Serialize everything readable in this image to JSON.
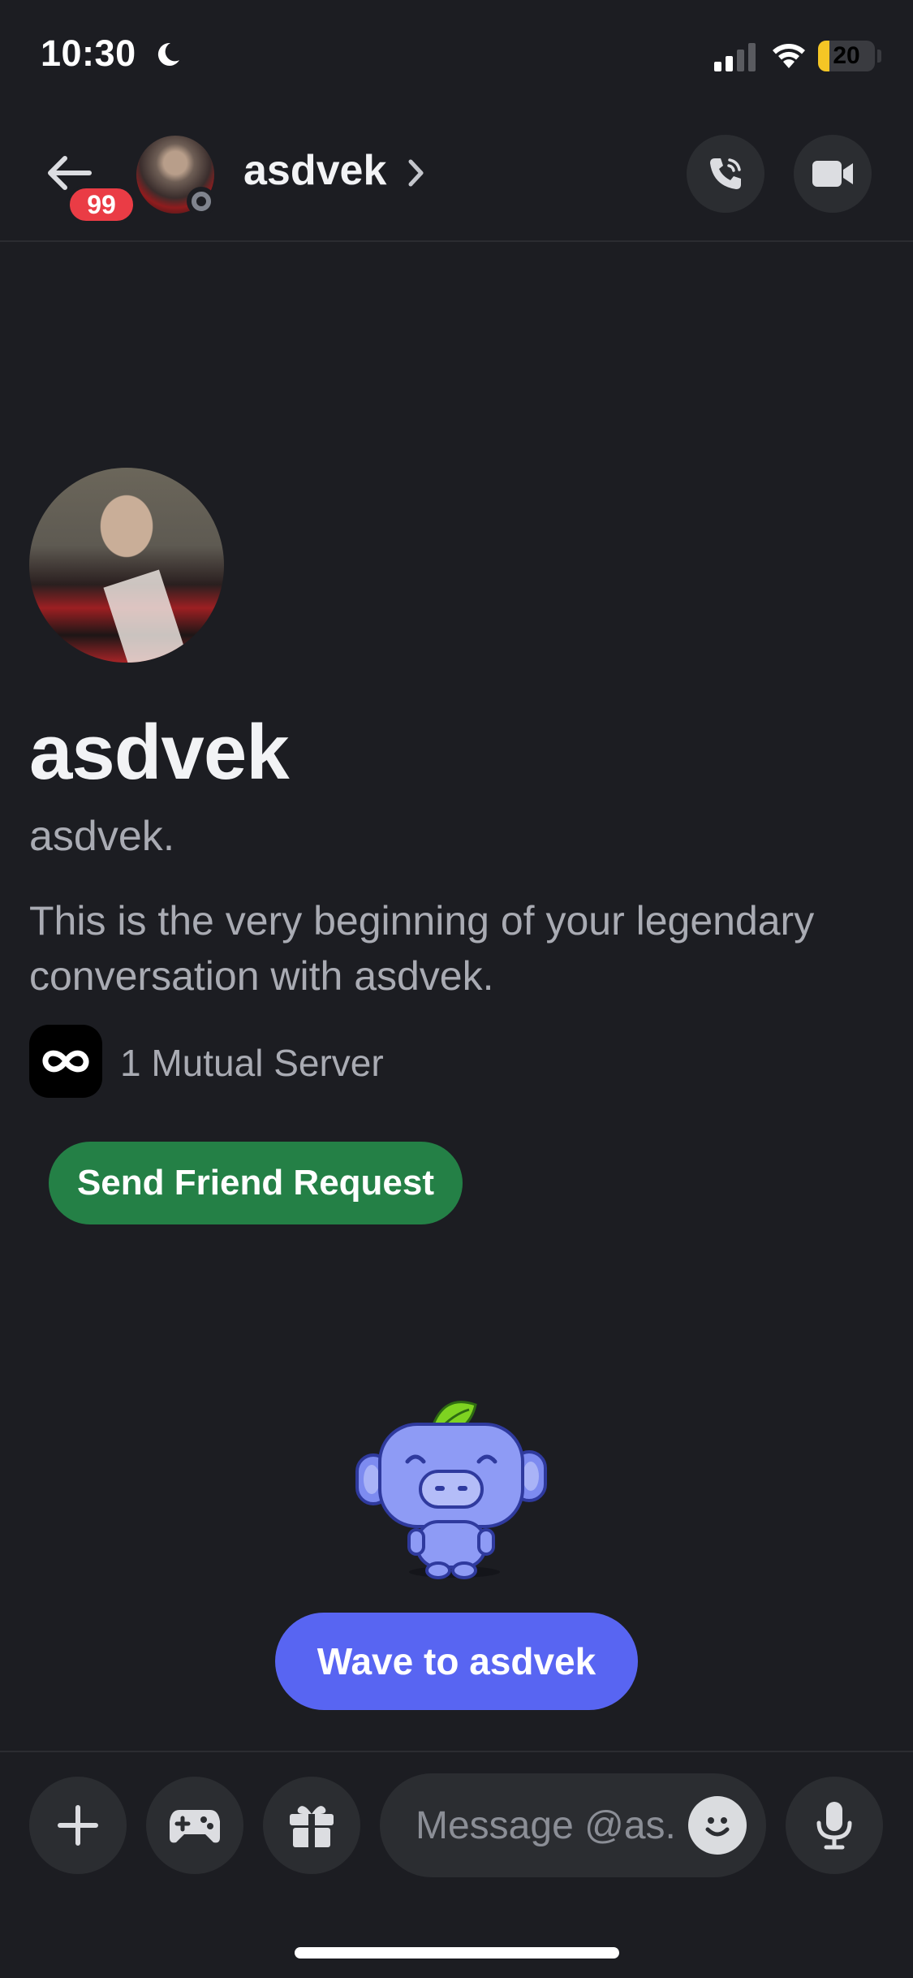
{
  "status_bar": {
    "time": "10:30",
    "battery_level": "20",
    "battery_fraction": 0.2
  },
  "header": {
    "unread_badge": "99",
    "name": "asdvek"
  },
  "profile": {
    "display_name": "asdvek",
    "username": "asdvek.",
    "intro": "This is the very beginning of your legendary conversation with asdvek.",
    "mutual_servers": "1 Mutual Server",
    "friend_request_label": "Send Friend Request"
  },
  "wave": {
    "label": "Wave to asdvek"
  },
  "composer": {
    "placeholder": "Message @as.."
  },
  "colors": {
    "background": "#1c1d22",
    "blurple": "#5865f2",
    "green": "#248046",
    "badge_red": "#ea3c45"
  },
  "icons": {
    "moon": "moon-icon",
    "signal": "signal-icon",
    "wifi": "wifi-icon",
    "back": "back-arrow-icon",
    "chevron": "chevron-right-icon",
    "call": "phone-icon",
    "video": "video-camera-icon",
    "server": "infinity-icon",
    "plus": "plus-icon",
    "game": "gamepad-icon",
    "gift": "gift-icon",
    "emoji": "smiley-icon",
    "mic": "microphone-icon"
  }
}
